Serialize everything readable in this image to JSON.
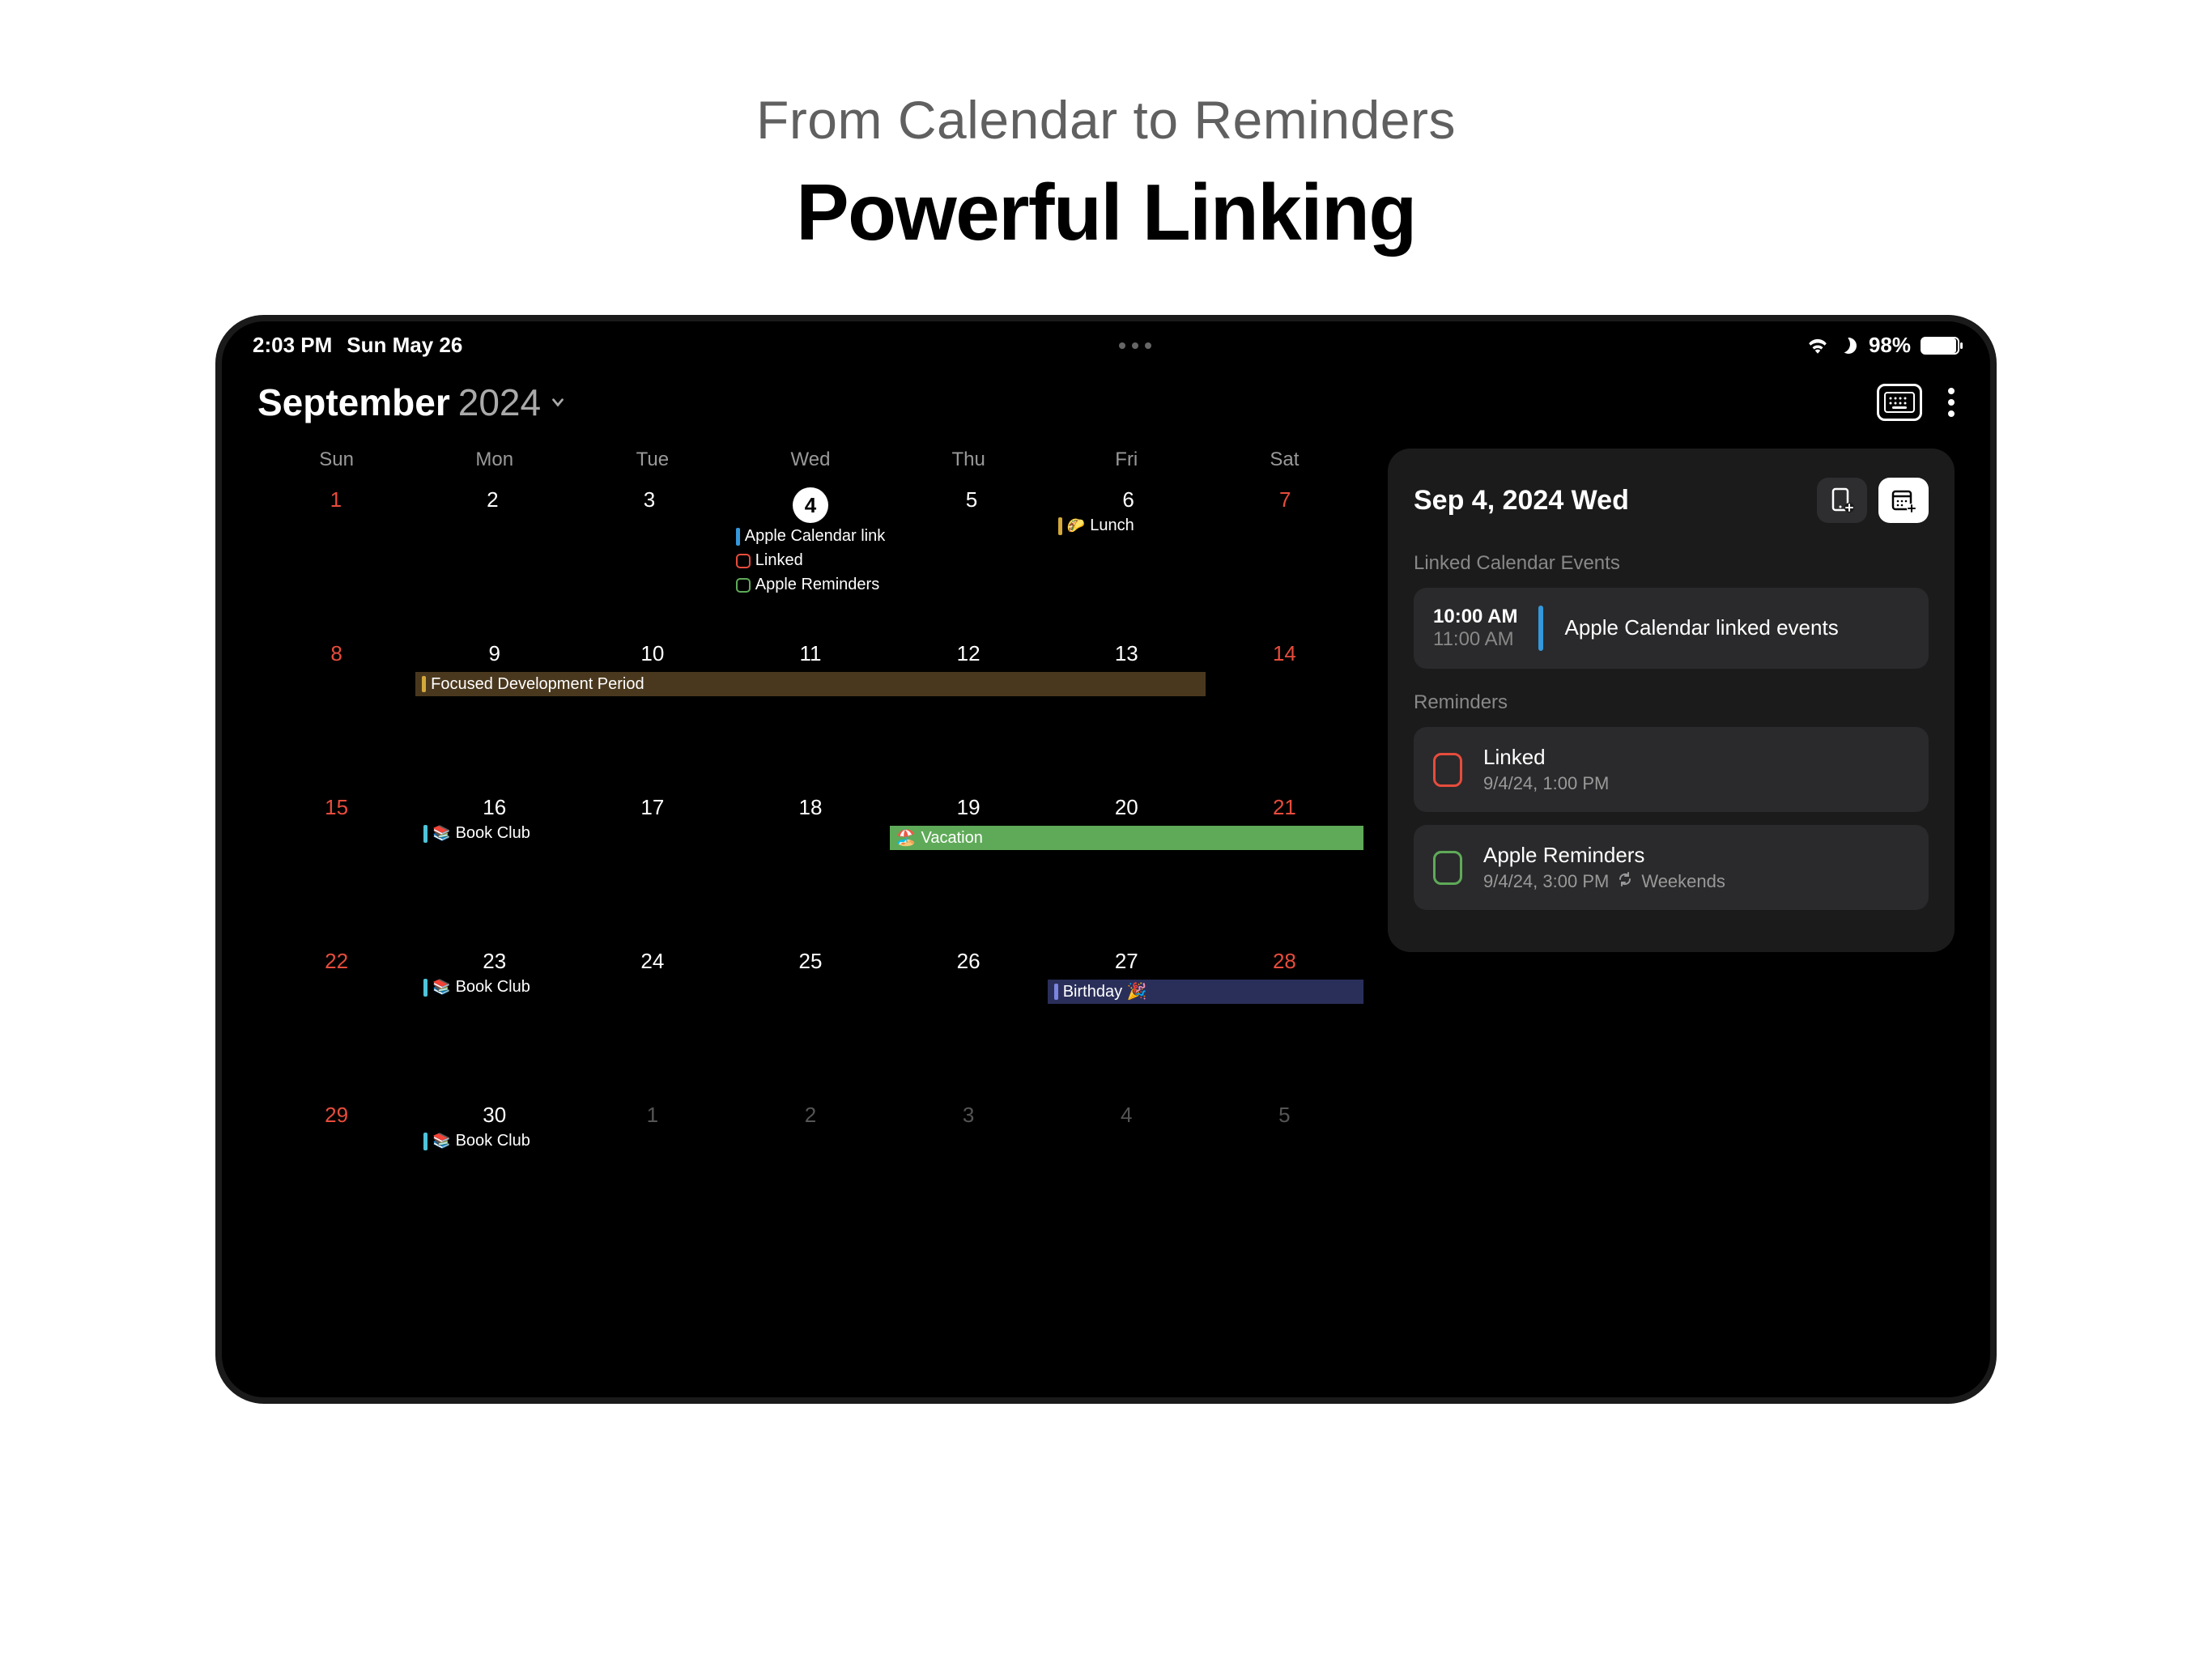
{
  "marketing": {
    "subtitle": "From Calendar to Reminders",
    "title": "Powerful Linking"
  },
  "status": {
    "time": "2:03 PM",
    "date": "Sun May 26",
    "battery_pct": "98%"
  },
  "header": {
    "month": "September",
    "year": "2024"
  },
  "weekdays": [
    "Sun",
    "Mon",
    "Tue",
    "Wed",
    "Thu",
    "Fri",
    "Sat"
  ],
  "weeks": [
    {
      "days": [
        {
          "n": "1",
          "cls": "weekend"
        },
        {
          "n": "2"
        },
        {
          "n": "3"
        },
        {
          "n": "4",
          "selected": true,
          "events": [
            {
              "type": "bar",
              "color": "#3498db",
              "label": "Apple Calendar link"
            },
            {
              "type": "box",
              "color": "#e74c3c",
              "label": "Linked"
            },
            {
              "type": "box",
              "color": "#5faa58",
              "label": "Apple Reminders"
            }
          ]
        },
        {
          "n": "5"
        },
        {
          "n": "6",
          "events": [
            {
              "type": "bar",
              "color": "#d4a93a",
              "emoji": "🌮",
              "label": "Lunch"
            }
          ]
        },
        {
          "n": "7",
          "cls": "weekend"
        }
      ]
    },
    {
      "days": [
        {
          "n": "8",
          "cls": "weekend"
        },
        {
          "n": "9"
        },
        {
          "n": "10"
        },
        {
          "n": "11"
        },
        {
          "n": "12"
        },
        {
          "n": "13"
        },
        {
          "n": "14",
          "cls": "weekend"
        }
      ],
      "spans": [
        {
          "startCol": 2,
          "endCol": 6,
          "bg": "span-brown",
          "barColor": "#d4a93a",
          "label": "Focused Development Period"
        }
      ]
    },
    {
      "days": [
        {
          "n": "15",
          "cls": "weekend"
        },
        {
          "n": "16",
          "events": [
            {
              "type": "bar",
              "color": "#4fc3d9",
              "emoji": "📚",
              "label": "Book Club"
            }
          ]
        },
        {
          "n": "17"
        },
        {
          "n": "18"
        },
        {
          "n": "19"
        },
        {
          "n": "20"
        },
        {
          "n": "21",
          "cls": "weekend"
        }
      ],
      "spans": [
        {
          "startCol": 5,
          "endCol": 7,
          "bg": "span-green-start",
          "emoji": "🏖️",
          "label": "Vacation"
        }
      ]
    },
    {
      "days": [
        {
          "n": "22",
          "cls": "weekend"
        },
        {
          "n": "23",
          "events": [
            {
              "type": "bar",
              "color": "#4fc3d9",
              "emoji": "📚",
              "label": "Book Club"
            }
          ]
        },
        {
          "n": "24"
        },
        {
          "n": "25"
        },
        {
          "n": "26"
        },
        {
          "n": "27"
        },
        {
          "n": "28",
          "cls": "weekend"
        }
      ],
      "spans": [
        {
          "startCol": 6,
          "endCol": 7,
          "bg": "span-navy",
          "barColor": "#7a85e0",
          "label": "Birthday 🎉"
        }
      ]
    },
    {
      "days": [
        {
          "n": "29",
          "cls": "weekend"
        },
        {
          "n": "30",
          "events": [
            {
              "type": "bar",
              "color": "#4fc3d9",
              "emoji": "📚",
              "label": "Book Club"
            }
          ]
        },
        {
          "n": "1",
          "cls": "other-month"
        },
        {
          "n": "2",
          "cls": "other-month"
        },
        {
          "n": "3",
          "cls": "other-month"
        },
        {
          "n": "4",
          "cls": "other-month"
        },
        {
          "n": "5",
          "cls": "other-month weekend"
        }
      ]
    }
  ],
  "panel": {
    "date": "Sep 4, 2024 Wed",
    "section_events": "Linked Calendar Events",
    "event": {
      "start": "10:00 AM",
      "end": "11:00 AM",
      "color": "#3498db",
      "title": "Apple Calendar linked events"
    },
    "section_reminders": "Reminders",
    "reminders": [
      {
        "color": "#e74c3c",
        "title": "Linked",
        "meta": "9/4/24, 1:00 PM",
        "repeat": ""
      },
      {
        "color": "#5faa58",
        "title": "Apple Reminders",
        "meta": "9/4/24, 3:00 PM",
        "repeat": "Weekends"
      }
    ]
  }
}
